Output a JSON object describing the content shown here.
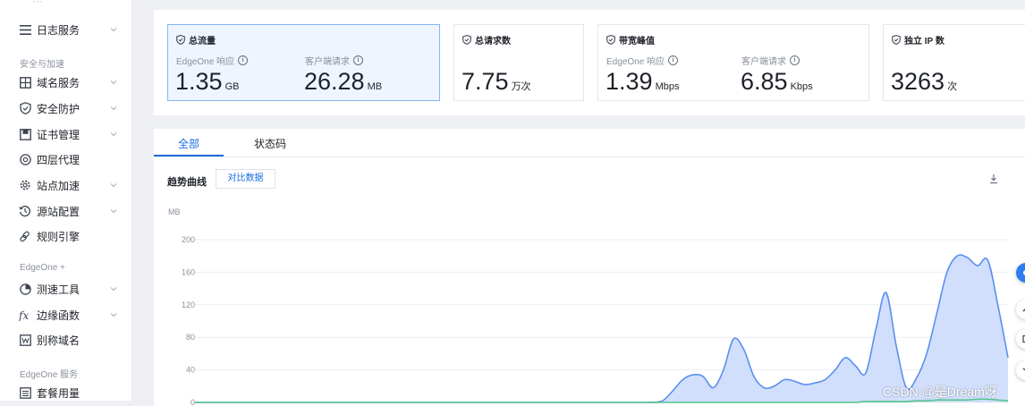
{
  "sidebar": {
    "groups": [
      {
        "label": "安全与加速"
      },
      {
        "label": "EdgeOne +"
      },
      {
        "label": "EdgeOne 服务"
      }
    ],
    "items": [
      {
        "label": "日志服务",
        "icon": "list-icon",
        "chevron": true
      },
      {
        "label": "域名服务",
        "icon": "domain-grid-icon",
        "chevron": true
      },
      {
        "label": "安全防护",
        "icon": "shield-icon",
        "chevron": true
      },
      {
        "label": "证书管理",
        "icon": "certificate-icon",
        "chevron": true
      },
      {
        "label": "四层代理",
        "icon": "proxy-icon",
        "chevron": false
      },
      {
        "label": "站点加速",
        "icon": "gear-icon",
        "chevron": true
      },
      {
        "label": "源站配置",
        "icon": "history-clock-icon",
        "chevron": true
      },
      {
        "label": "规则引擎",
        "icon": "link-icon",
        "chevron": false
      },
      {
        "label": "测速工具",
        "icon": "pie-chart-icon",
        "chevron": true
      },
      {
        "label": "边缘函数",
        "icon": "function-icon",
        "chevron": true
      },
      {
        "label": "别称域名",
        "icon": "alias-icon",
        "chevron": false
      },
      {
        "label": "套餐用量",
        "icon": "package-icon",
        "chevron": false
      }
    ]
  },
  "stats": {
    "cards": [
      {
        "title": "总流量",
        "active": true,
        "metrics": [
          {
            "label": "EdgeOne 响应",
            "value": "1.35",
            "unit": "GB"
          },
          {
            "label": "客户端请求",
            "value": "26.28",
            "unit": "MB"
          }
        ]
      },
      {
        "title": "总请求数",
        "active": false,
        "metrics": [
          {
            "label": "",
            "value": "7.75",
            "unit": "万次"
          }
        ]
      },
      {
        "title": "带宽峰值",
        "active": false,
        "metrics": [
          {
            "label": "EdgeOne 响应",
            "value": "1.39",
            "unit": "Mbps"
          },
          {
            "label": "客户端请求",
            "value": "6.85",
            "unit": "Kbps"
          }
        ]
      },
      {
        "title": "独立 IP 数",
        "active": false,
        "metrics": [
          {
            "label": "",
            "value": "3263",
            "unit": "次"
          }
        ]
      }
    ]
  },
  "tabs": [
    {
      "label": "全部",
      "active": true
    },
    {
      "label": "状态码",
      "active": false
    }
  ],
  "chart_section": {
    "title": "趋势曲线",
    "compare_button": "对比数据"
  },
  "chart_data": {
    "type": "area",
    "ylabel": "MB",
    "ylim": [
      0,
      200
    ],
    "yticks": [
      0,
      40,
      80,
      120,
      160,
      200
    ],
    "series": [
      {
        "values": [
          0,
          0,
          0,
          0,
          0,
          0,
          0,
          0,
          0,
          0,
          0,
          0,
          0,
          0,
          0,
          0,
          0,
          0,
          0,
          0,
          0,
          0,
          0,
          0,
          0,
          0,
          0,
          0,
          0,
          0,
          0,
          0,
          0,
          0,
          0,
          0,
          0,
          0,
          0,
          0,
          0,
          0,
          0,
          0,
          0,
          0,
          2,
          14,
          28,
          34,
          32,
          18,
          40,
          78,
          65,
          32,
          18,
          20,
          28,
          26,
          22,
          24,
          28,
          40,
          55,
          45,
          36,
          90,
          135,
          70,
          18,
          30,
          60,
          110,
          160,
          180,
          178,
          168,
          175,
          120,
          55
        ],
        "color": "#5b8ff0",
        "fill": "#c9d9fb"
      },
      {
        "values": [
          0,
          0,
          0,
          0,
          0,
          0,
          0,
          0,
          0,
          0,
          0,
          0,
          0,
          0,
          0,
          0,
          0,
          0,
          0,
          0,
          0,
          0,
          0,
          0,
          0,
          0,
          0,
          0,
          0,
          0,
          0,
          0,
          0,
          0,
          0,
          0,
          0,
          0,
          0,
          0,
          0,
          0,
          0,
          0,
          0,
          0,
          0,
          0,
          0,
          0,
          0,
          0,
          0,
          0,
          0,
          0,
          0,
          0,
          0,
          0,
          0,
          0,
          0,
          0,
          0,
          0,
          1,
          1,
          1,
          1,
          1,
          2,
          2,
          3,
          3,
          3,
          3,
          4,
          4,
          3,
          2
        ],
        "color": "#55c28a",
        "fill": "none"
      }
    ]
  },
  "colors": {
    "accent": "#1a6ce0",
    "active_card_bg": "#eef5ff",
    "active_card_border": "#86b3f3"
  },
  "watermark": "CSDN @是Dream呀"
}
